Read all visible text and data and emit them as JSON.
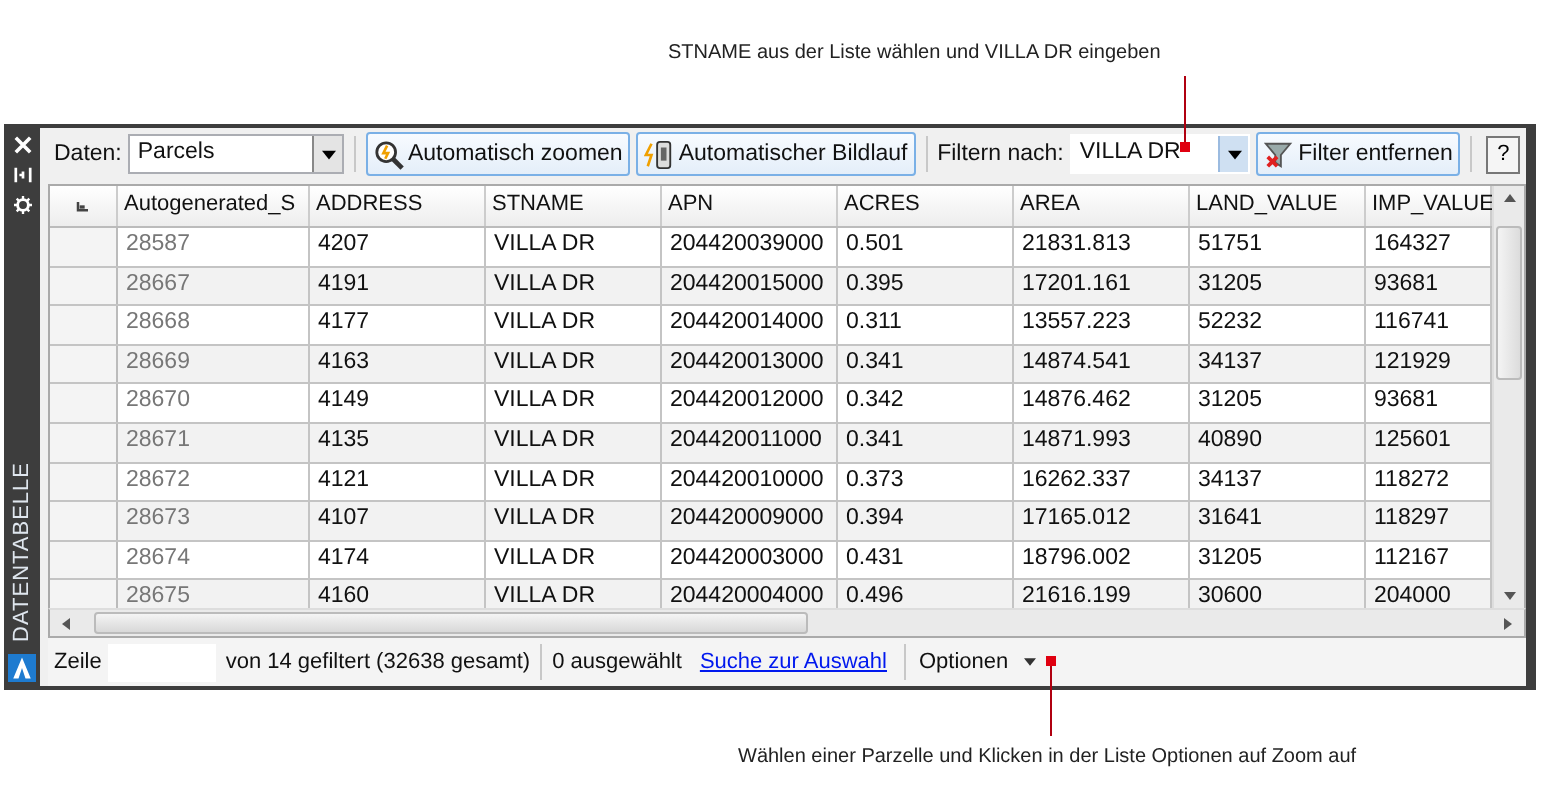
{
  "annotations": [
    {
      "text": "STNAME aus der Liste wählen und VILLA DR eingeben"
    },
    {
      "text": "Wählen einer Parzelle und Klicken in der Liste Optionen auf Zoom auf"
    }
  ],
  "side_panel": {
    "title": "DATENTABELLE"
  },
  "toolbar": {
    "data_label": "Daten:",
    "data_value": "Parcels",
    "buttons": [
      {
        "label": "Automatisch zoomen",
        "kind": "zoom"
      },
      {
        "label": "Automatischer Bildlauf",
        "kind": "scroll"
      }
    ],
    "filter_label": "Filtern nach:",
    "filter_value": "VILLA DR",
    "remove_filter": "Filter entfernen",
    "help": "?"
  },
  "table": {
    "columns": [
      "Autogenerated_S",
      "ADDRESS",
      "STNAME",
      "APN",
      "ACRES",
      "AREA",
      "LAND_VALUE",
      "IMP_VALUE"
    ],
    "rows": [
      [
        "28587",
        "4207",
        "VILLA DR",
        "204420039000",
        "0.501",
        "21831.813",
        "51751",
        "164327"
      ],
      [
        "28667",
        "4191",
        "VILLA DR",
        "204420015000",
        "0.395",
        "17201.161",
        "31205",
        "93681"
      ],
      [
        "28668",
        "4177",
        "VILLA DR",
        "204420014000",
        "0.311",
        "13557.223",
        "52232",
        "116741"
      ],
      [
        "28669",
        "4163",
        "VILLA DR",
        "204420013000",
        "0.341",
        "14874.541",
        "34137",
        "121929"
      ],
      [
        "28670",
        "4149",
        "VILLA DR",
        "204420012000",
        "0.342",
        "14876.462",
        "31205",
        "93681"
      ],
      [
        "28671",
        "4135",
        "VILLA DR",
        "204420011000",
        "0.341",
        "14871.993",
        "40890",
        "125601"
      ],
      [
        "28672",
        "4121",
        "VILLA DR",
        "204420010000",
        "0.373",
        "16262.337",
        "34137",
        "118272"
      ],
      [
        "28673",
        "4107",
        "VILLA DR",
        "204420009000",
        "0.394",
        "17165.012",
        "31641",
        "118297"
      ],
      [
        "28674",
        "4174",
        "VILLA DR",
        "204420003000",
        "0.431",
        "18796.002",
        "31205",
        "112167"
      ],
      [
        "28675",
        "4160",
        "VILLA DR",
        "204420004000",
        "0.496",
        "21616.199",
        "30600",
        "204000"
      ]
    ]
  },
  "status_bar": {
    "row_label": "Zeile",
    "filter_info": "von 14 gefiltert (32638 gesamt)",
    "selected_info": "0 ausgewählt",
    "link": "Suche zur Auswahl",
    "options": "Optionen"
  }
}
